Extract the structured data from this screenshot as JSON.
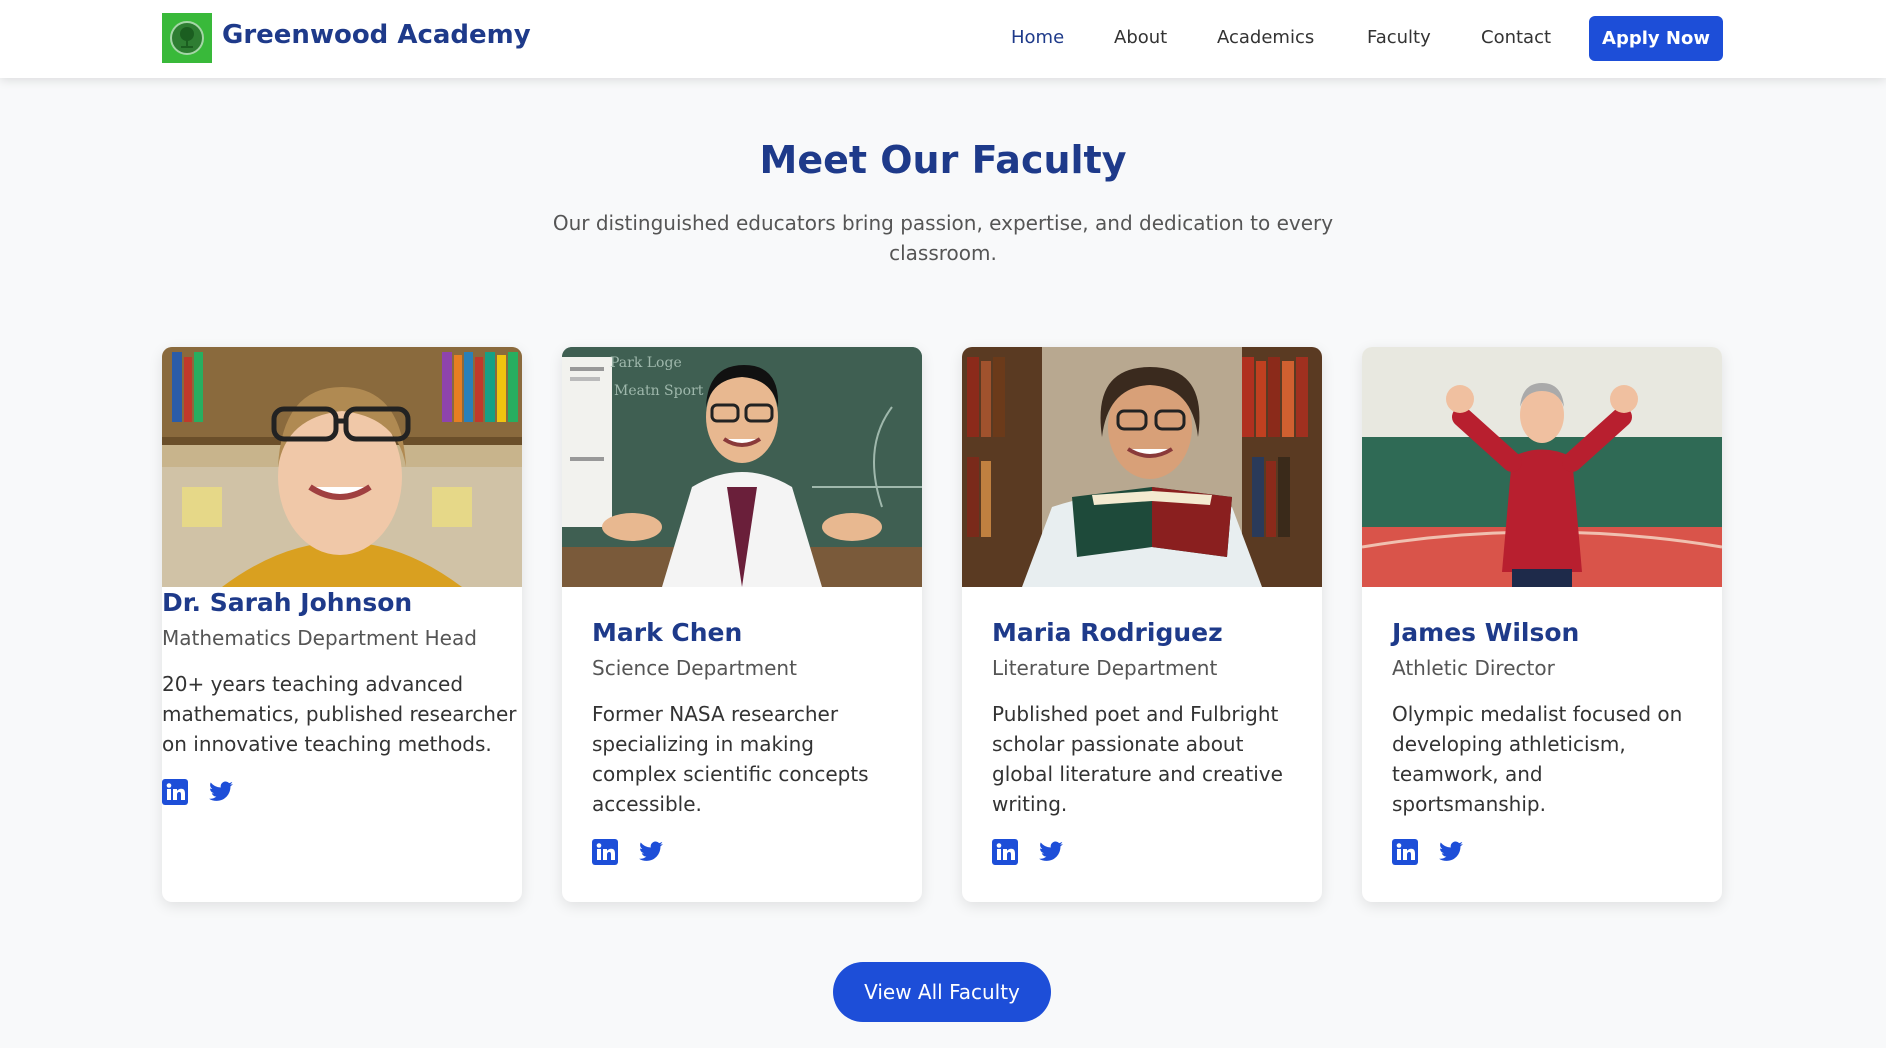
{
  "header": {
    "brand": "Greenwood Academy",
    "logo_icon": "tree-seal-icon",
    "nav": [
      {
        "label": "Home",
        "active": true
      },
      {
        "label": "About",
        "active": false
      },
      {
        "label": "Academics",
        "active": false
      },
      {
        "label": "Faculty",
        "active": false
      },
      {
        "label": "Contact",
        "active": false
      }
    ],
    "cta_label": "Apply Now"
  },
  "section": {
    "title": "Meet Our Faculty",
    "subtitle": "Our distinguished educators bring passion, expertise, and dedication to every classroom."
  },
  "faculty": [
    {
      "name": "Dr. Sarah Johnson",
      "role": "Mathematics Department Head",
      "bio": "20+ years teaching advanced mathematics, published researcher on innovative teaching methods.",
      "photo": "woman-with-glasses-library-photo"
    },
    {
      "name": "Mark Chen",
      "role": "Science Department",
      "bio": "Former NASA researcher specializing in making complex scientific concepts accessible.",
      "photo": "man-in-lab-coat-chalkboard-photo"
    },
    {
      "name": "Maria Rodriguez",
      "role": "Literature Department",
      "bio": "Published poet and Fulbright scholar passionate about global literature and creative writing.",
      "photo": "woman-holding-book-bookshelf-photo"
    },
    {
      "name": "James Wilson",
      "role": "Athletic Director",
      "bio": "Olympic medalist focused on developing athleticism, teamwork, and sportsmanship.",
      "photo": "man-in-red-sweater-gym-photo"
    }
  ],
  "social_icons": [
    "linkedin-icon",
    "twitter-icon"
  ],
  "view_all_label": "View All Faculty",
  "colors": {
    "primary": "#1d4ed8",
    "heading": "#1e3a8a",
    "logo_bg": "#39b93a",
    "page_bg": "#f8f9fa"
  }
}
